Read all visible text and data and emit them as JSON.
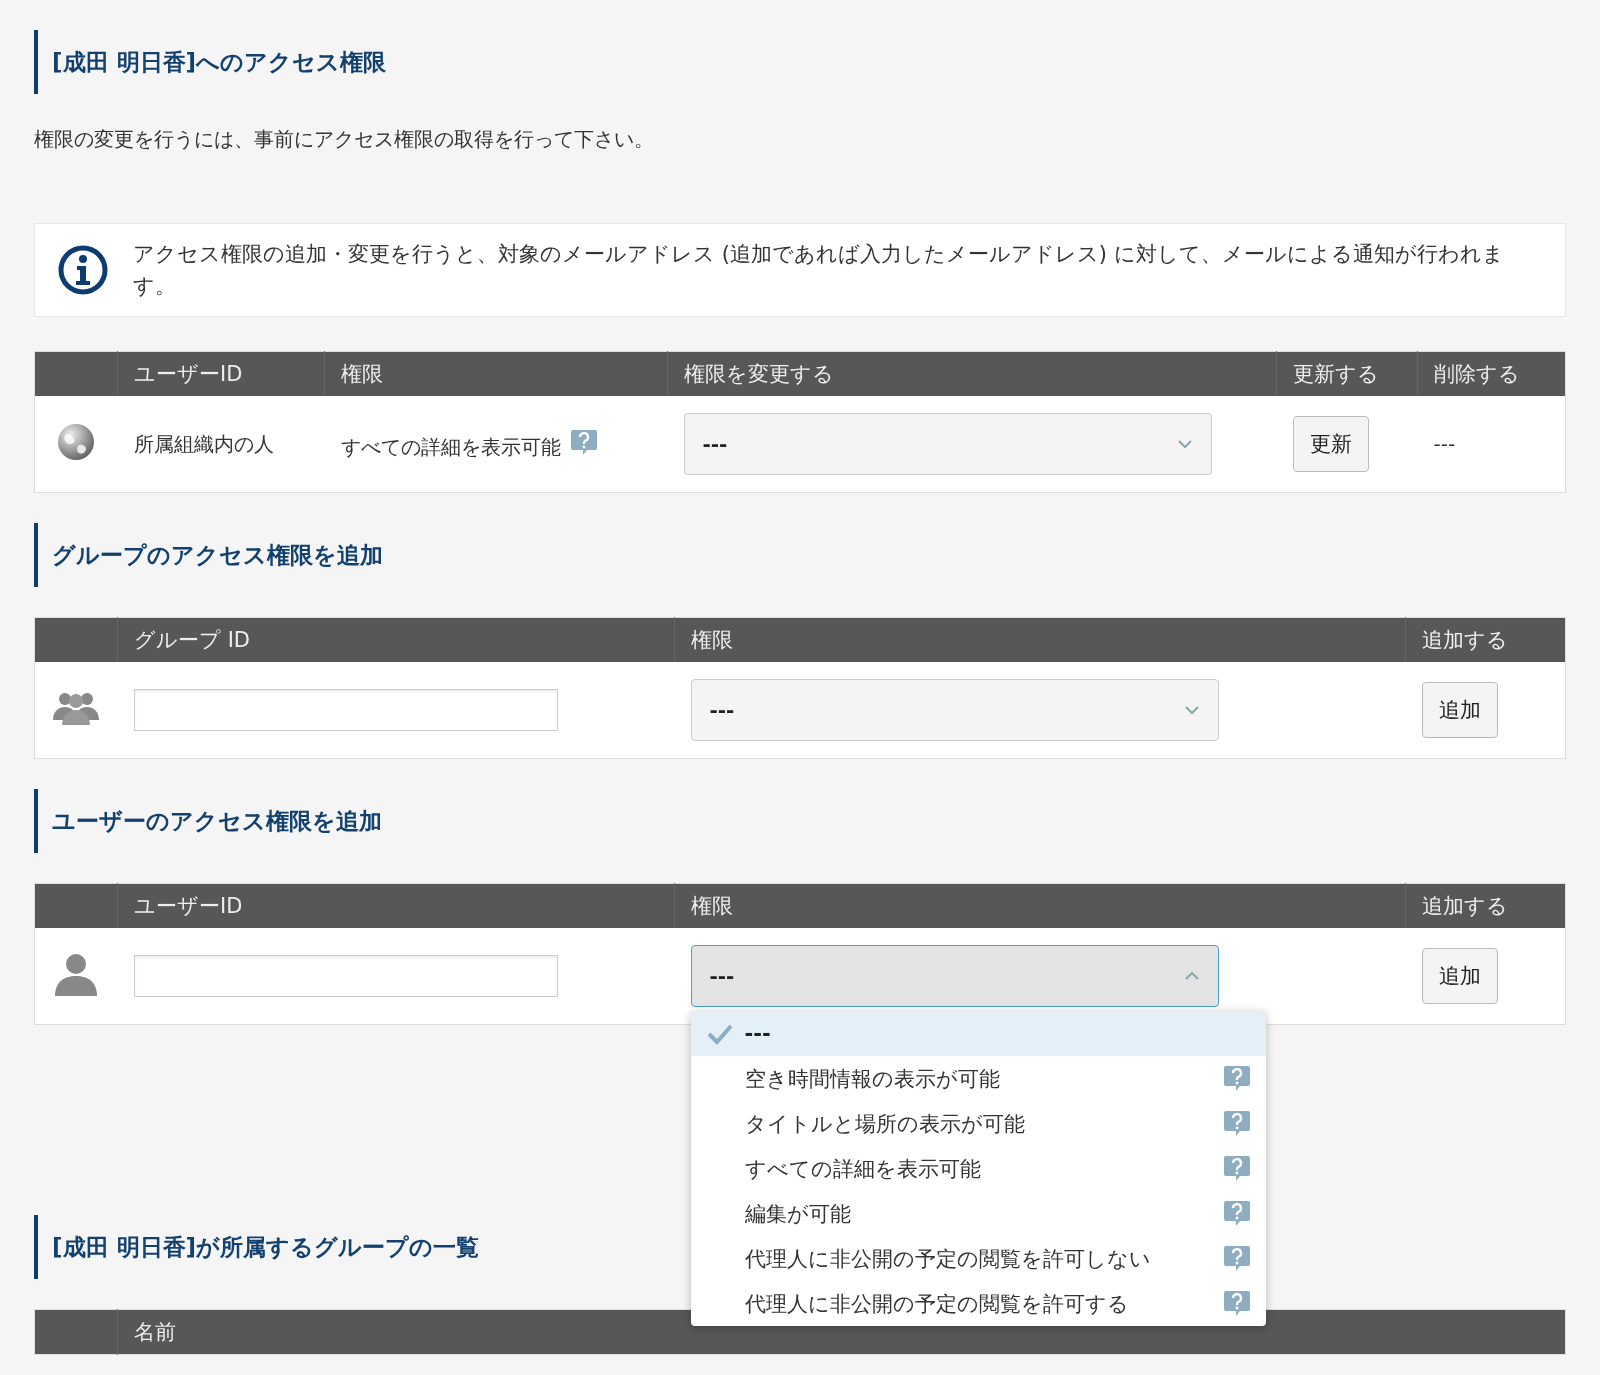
{
  "title": "[成田 明日香]へのアクセス権限",
  "note": "権限の変更を行うには、事前にアクセス権限の取得を行って下さい。",
  "info": "アクセス権限の追加・変更を行うと、対象のメールアドレス (追加であれば入力したメールアドレス) に対して、メールによる通知が行われます。",
  "access_table": {
    "columns": [
      "ユーザーID",
      "権限",
      "権限を変更する",
      "更新する",
      "削除する"
    ],
    "rows": [
      {
        "user": "所属組織内の人",
        "permission": "すべての詳細を表示可能",
        "select": {
          "value": "---",
          "expanded": false
        },
        "update_button": "更新",
        "delete": "---"
      }
    ]
  },
  "add_sections": [
    {
      "kind": "group",
      "title": "グループのアクセス権限を追加",
      "columns": [
        "グループ ID",
        "権限",
        "追加する"
      ],
      "select": {
        "value": "---",
        "expanded": false
      },
      "button": "追加"
    },
    {
      "kind": "user",
      "title": "ユーザーのアクセス権限を追加",
      "columns": [
        "ユーザーID",
        "権限",
        "追加する"
      ],
      "select": {
        "value": "---",
        "expanded": true,
        "options": [
          {
            "label": "---",
            "selected": true,
            "help": false
          },
          {
            "label": "空き時間情報の表示が可能",
            "selected": false,
            "help": true
          },
          {
            "label": "タイトルと場所の表示が可能",
            "selected": false,
            "help": true
          },
          {
            "label": "すべての詳細を表示可能",
            "selected": false,
            "help": true
          },
          {
            "label": "編集が可能",
            "selected": false,
            "help": true
          },
          {
            "label": "代理人に非公開の予定の閲覧を許可しない",
            "selected": false,
            "help": true
          },
          {
            "label": "代理人に非公開の予定の閲覧を許可する",
            "selected": false,
            "help": true
          }
        ]
      },
      "button": "追加"
    }
  ],
  "groups_list": {
    "title": "[成田 明日香]が所属するグループの一覧",
    "columns": [
      "名前"
    ]
  }
}
